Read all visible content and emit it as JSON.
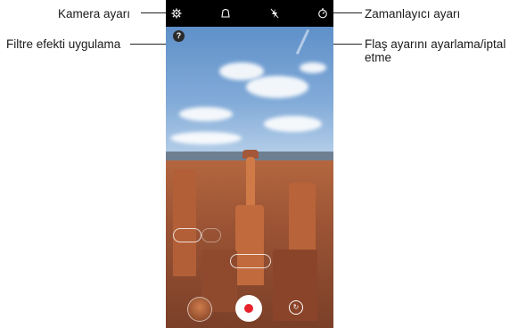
{
  "callouts": {
    "camera_settings": "Kamera ayarı",
    "apply_filter": "Filtre efekti uygulama",
    "timer_settings": "Zamanlayıcı ayarı",
    "flash_toggle": "Flaş ayarını ayarlama/iptal etme"
  },
  "icons": {
    "settings": "gear-icon",
    "filter": "filter-icon",
    "flash": "flash-off-icon",
    "timer": "timer-icon",
    "help": "help-icon",
    "switch_camera": "switch-camera-icon"
  },
  "topbar": {
    "help_label": "?"
  },
  "colors": {
    "record": "#e8222a",
    "bar": "#000000"
  }
}
